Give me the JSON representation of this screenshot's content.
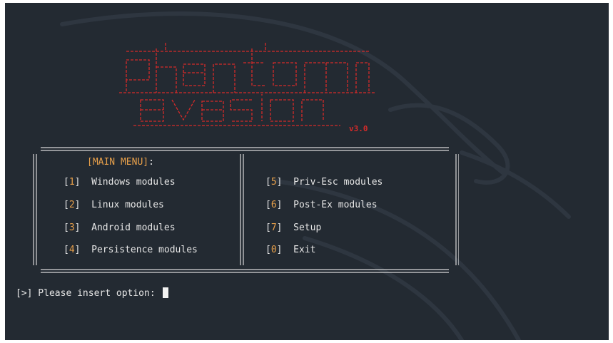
{
  "logo": {
    "name": "phantom evasion",
    "version": "v3.0"
  },
  "menu": {
    "title": "[MAIN MENU]",
    "title_suffix": ":",
    "options_left": [
      {
        "num": "1",
        "label": "Windows modules"
      },
      {
        "num": "2",
        "label": "Linux modules"
      },
      {
        "num": "3",
        "label": "Android modules"
      },
      {
        "num": "4",
        "label": "Persistence modules"
      }
    ],
    "options_right": [
      {
        "num": "5",
        "label": "Priv-Esc modules"
      },
      {
        "num": "6",
        "label": "Post-Ex modules"
      },
      {
        "num": "7",
        "label": "Setup"
      },
      {
        "num": "0",
        "label": "Exit"
      }
    ]
  },
  "prompt": {
    "text": "[>] Please insert option: "
  },
  "colors": {
    "background": "#232a32",
    "logo_red": "#d42a2a",
    "option_number": "#e8a04a",
    "text": "#e6e6e6"
  }
}
